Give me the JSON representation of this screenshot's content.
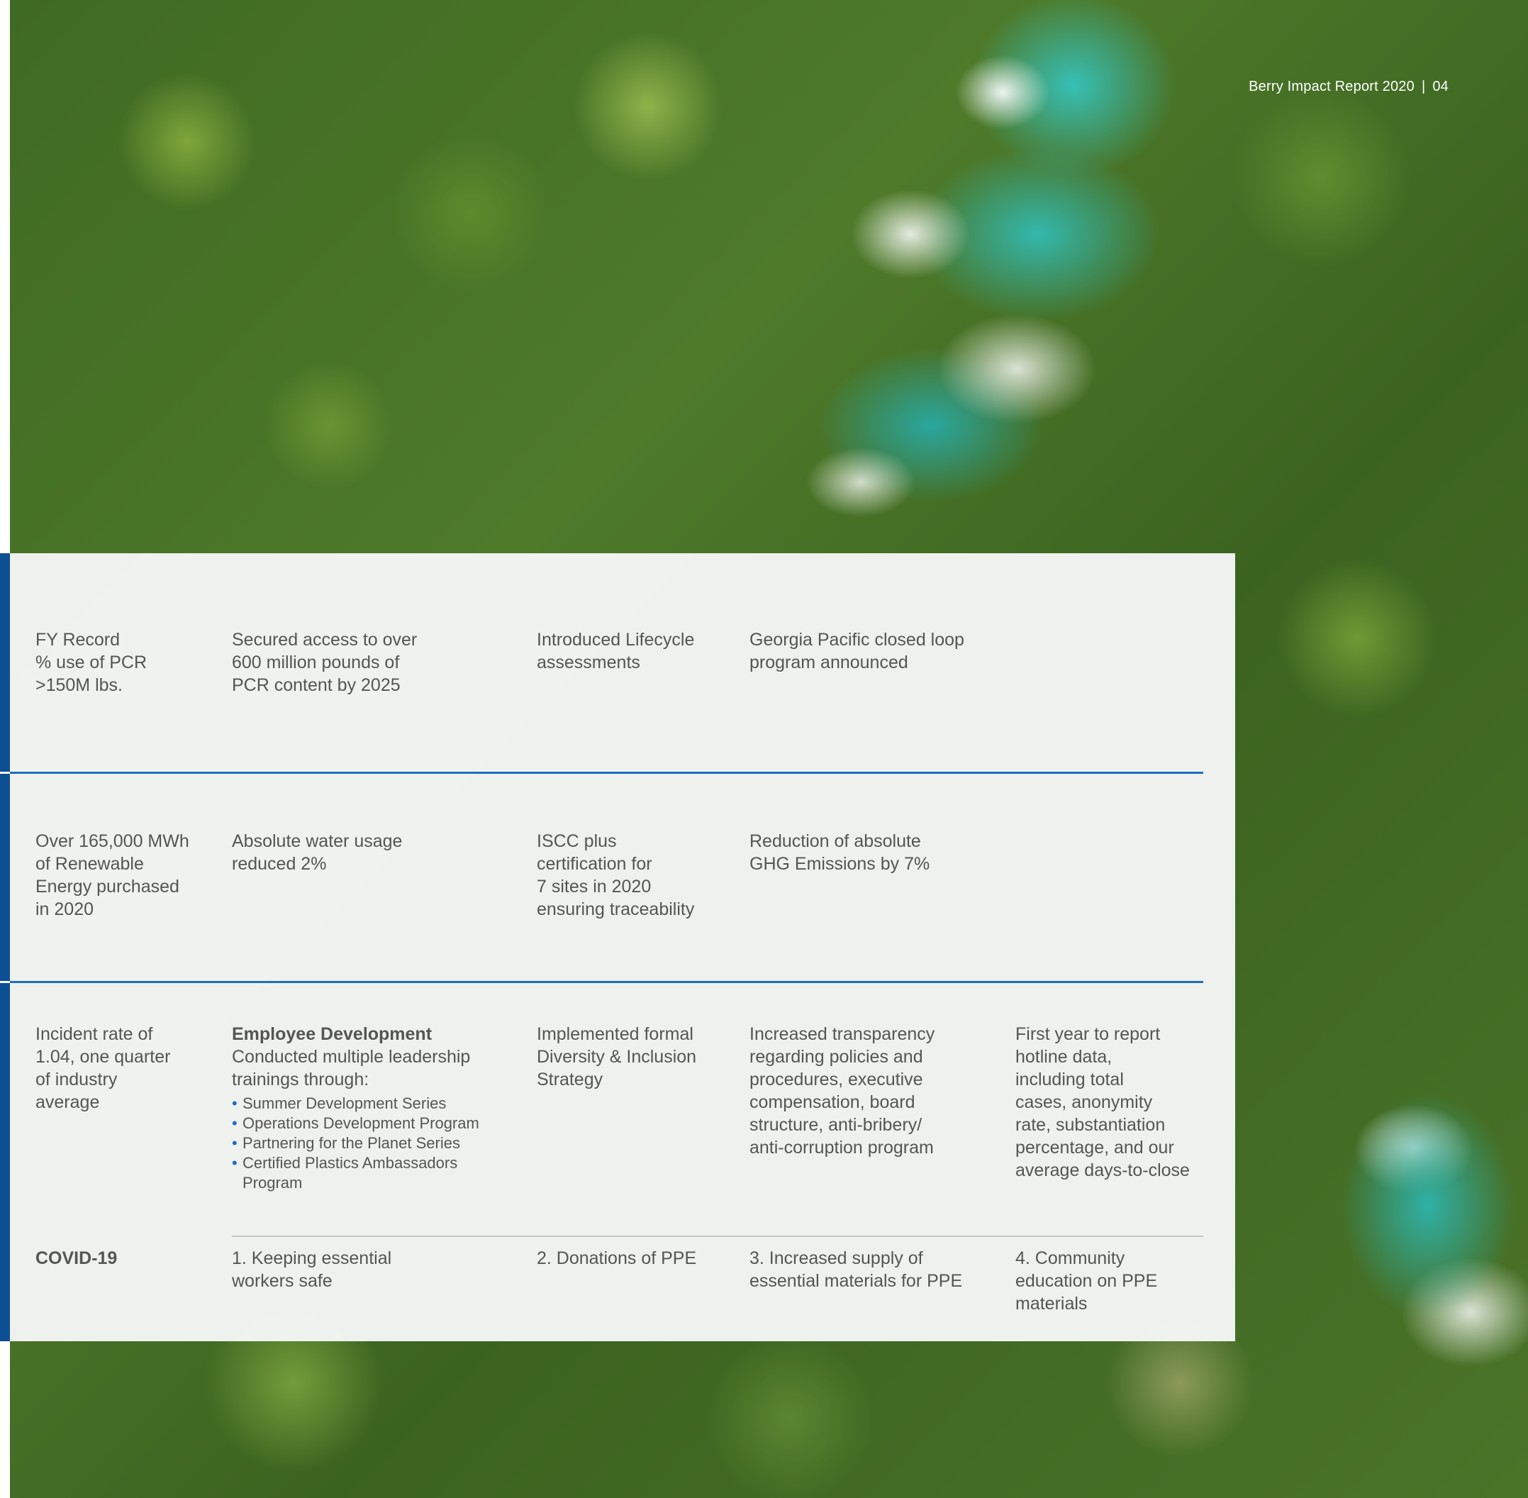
{
  "header": {
    "title": "Berry Impact Report 2020",
    "page": "04"
  },
  "rows": [
    {
      "cells": [
        "FY Record\n% use of PCR\n>150M lbs.",
        "Secured access to over\n600 million pounds of\nPCR content by 2025",
        "Introduced Lifecycle\nassessments",
        "Georgia Pacific closed loop\nprogram announced"
      ]
    },
    {
      "cells": [
        "Over 165,000 MWh\nof Renewable\nEnergy purchased\nin 2020",
        "Absolute water usage\nreduced 2%",
        "ISCC plus\ncertification for\n7 sites in 2020\nensuring traceability",
        "Reduction of absolute\nGHG Emissions by 7%"
      ]
    },
    {
      "cells": [
        "Incident rate of\n1.04, one quarter\nof industry\naverage",
        "",
        "Implemented formal\nDiversity & Inclusion\nStrategy",
        "Increased transparency\nregarding policies and\nprocedures, executive\ncompensation, board\nstructure, anti-bribery/\nanti-corruption program",
        "First year to report\nhotline data,\nincluding total\ncases, anonymity\nrate, substantiation\npercentage, and our\naverage days-to-close"
      ],
      "employee_development": {
        "title": "Employee Development",
        "text": "Conducted multiple leadership\ntrainings through:",
        "items": [
          "Summer Development Series",
          "Operations Development Program",
          "Partnering for the Planet Series",
          "Certified Plastics Ambassadors\nProgram"
        ]
      }
    },
    {
      "cells": [
        "COVID-19",
        "1. Keeping essential\nworkers safe",
        "2. Donations of PPE",
        "3. Increased supply of\nessential materials for PPE",
        "4. Community\neducation on PPE\nmaterials"
      ]
    }
  ],
  "colors": {
    "accent_blue": "#0d4f93",
    "rule_blue": "#1d6fbe",
    "text_gray": "#555555"
  }
}
